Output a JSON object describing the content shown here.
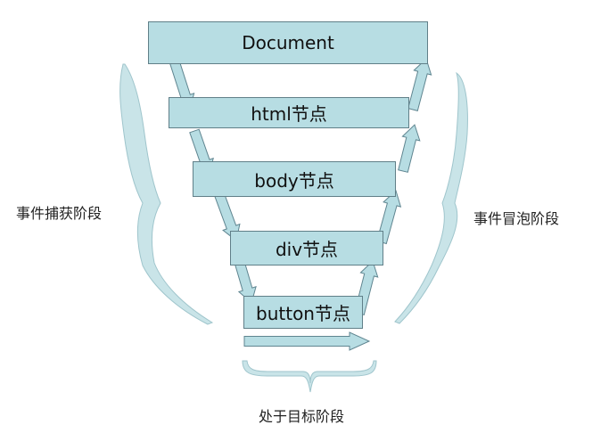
{
  "layers": [
    {
      "id": "document",
      "label": "Document"
    },
    {
      "id": "html",
      "label": "html节点"
    },
    {
      "id": "body",
      "label": "body节点"
    },
    {
      "id": "div",
      "label": "div节点"
    },
    {
      "id": "button",
      "label": "button节点"
    }
  ],
  "phases": {
    "capture_label": "事件捕获阶段",
    "bubble_label": "事件冒泡阶段",
    "target_label": "处于目标阶段"
  },
  "colors": {
    "box_fill": "#b7dde3",
    "box_stroke": "#607f88",
    "arrow_fill": "#b7dde3",
    "arrow_stroke": "#5f8590",
    "brace_fill": "#c9e4e8",
    "brace_stroke": "#9fc5cc"
  }
}
